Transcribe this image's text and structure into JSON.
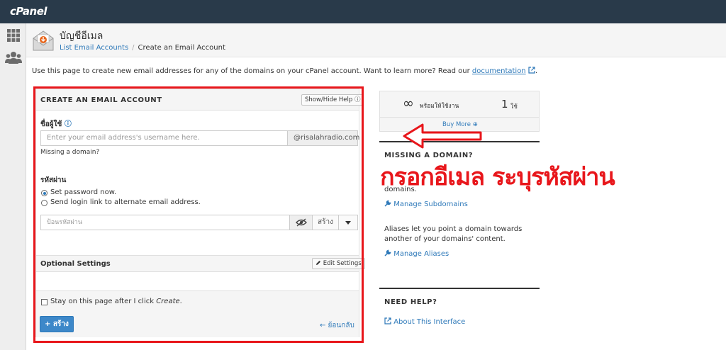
{
  "brand": {
    "logo": "cPanel"
  },
  "header": {
    "title": "บัญชีอีเมล",
    "breadcrumb_link": "List Email Accounts",
    "breadcrumb_sep": "/",
    "breadcrumb_current": "Create an Email Account"
  },
  "intro": {
    "text": "Use this page to create new email addresses for any of the domains on your cPanel account. Want to learn more? Read our",
    "link": "documentation",
    "end": "."
  },
  "form": {
    "title": "CREATE AN EMAIL ACCOUNT",
    "help_button": "Show/Hide Help ⓘ",
    "username_label": "ชื่อผู้ใช้",
    "username_help": "ⓘ",
    "username_placeholder": "Enter your email address's username here.",
    "domain": "@risalahradio.com",
    "missing_domain_link": "Missing a domain?",
    "password_label": "รหัสผ่าน",
    "radio_set_password": "Set password now.",
    "radio_send_link": "Send login link to alternate email address.",
    "password_placeholder": "ป้อนรหัสผ่าน",
    "generate_button": "สร้าง",
    "optional_label": "Optional Settings",
    "edit_settings": "Edit Settings",
    "stay_label_pre": "Stay on this page after I click ",
    "stay_label_em": "Create",
    "stay_label_post": ".",
    "create_button": "+ สร้าง",
    "back_link": "← ย้อนกลับ"
  },
  "stats": {
    "infinity": "∞",
    "available_label": "พร้อมให้ใช้งาน",
    "used_count": "1",
    "used_label": "ใช้",
    "buy_more": "Buy More ⊕"
  },
  "sidebar": {
    "missing_head": "MISSING A DOMAIN?",
    "missing_text": "domains.",
    "manage_subdomains": "Manage Subdomains",
    "aliases_text": "Aliases let you point a domain towards another of your domains' content.",
    "manage_aliases": "Manage Aliases",
    "help_head": "NEED HELP?",
    "about_interface": "About This Interface"
  },
  "annotation": {
    "text": "กรอกอีเมล ระบุรหัสผ่าน",
    "color": "#e8161b"
  }
}
